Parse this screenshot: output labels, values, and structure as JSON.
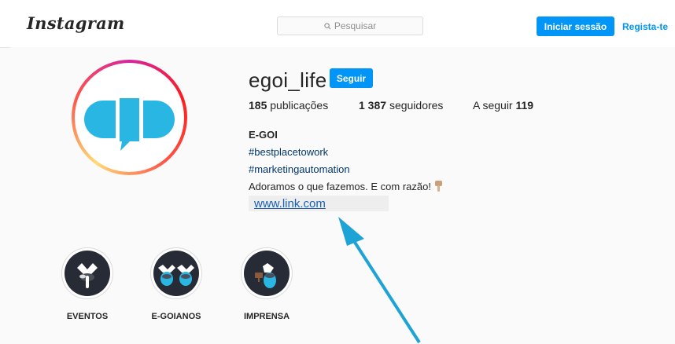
{
  "header": {
    "logo_text": "Instagram",
    "search_placeholder": "Pesquisar",
    "login_label": "Iniciar sessão",
    "register_label": "Regista-te"
  },
  "profile": {
    "username": "egoi_life",
    "follow_label": "Seguir",
    "posts_count": "185",
    "posts_label": "publicações",
    "followers_count": "1 387",
    "followers_label": "seguidores",
    "following_label": "A seguir",
    "following_count": "119",
    "name": "E-GOI",
    "hashtag1": "#bestplacetowork",
    "hashtag2": "#marketingautomation",
    "bio_text": "Adoramos o que fazemos. E com razão!",
    "link_text": "www.link.com"
  },
  "highlights": [
    {
      "label": "EVENTOS"
    },
    {
      "label": "E-GOIANOS"
    },
    {
      "label": "IMPRENSA"
    }
  ],
  "colors": {
    "accent": "#0095f6",
    "avatar_blue": "#29b6e3",
    "arrow": "#1ea3d6",
    "highlight_bg": "#262b35"
  },
  "icons": {
    "search": "search-icon",
    "hand": "pointing-down-hand-icon",
    "arrow": "annotation-arrow-icon"
  }
}
